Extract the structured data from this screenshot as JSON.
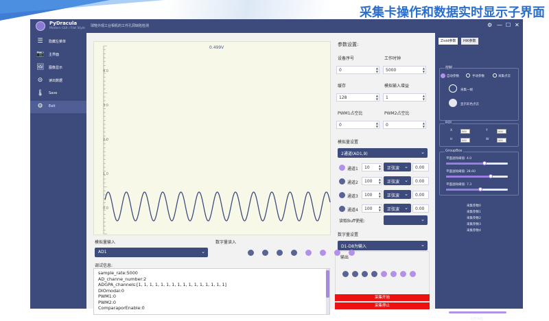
{
  "banner": {
    "title": "采集卡操作和数据实时显示子界面"
  },
  "app": {
    "name": "PyDracula",
    "subtitle": "Modern GUI / Flat Style",
    "description": "球鞋外观工业相机的工件孔洞缺陷检测",
    "controls": [
      "⚙",
      "—",
      "☐",
      "✕"
    ]
  },
  "sidebar": {
    "items": [
      {
        "label": "隐藏左菜单",
        "icon": "menu-icon",
        "glyph": "☰"
      },
      {
        "label": "主界面",
        "icon": "camera-icon",
        "glyph": "📷"
      },
      {
        "label": "图像显示",
        "icon": "image-icon",
        "glyph": "🖼"
      },
      {
        "label": "读出数据",
        "icon": "folder-open-icon",
        "glyph": "⊝"
      },
      {
        "label": "Save",
        "icon": "thermometer-icon",
        "glyph": "🌡"
      },
      {
        "label": "Exit",
        "icon": "chip-icon",
        "glyph": "⚙"
      }
    ]
  },
  "plot": {
    "value_label": "0.499V",
    "y_ticks": [
      "4.0",
      "3.0",
      "2.0",
      "1.0",
      "0.0"
    ],
    "color": "#3c4a7c",
    "background": "#f8f8e8"
  },
  "analog_input": {
    "label": "模拟量输入",
    "selected": "AD1"
  },
  "digital_input": {
    "label": "数字量读入",
    "dots": [
      "dark",
      "dark",
      "dark",
      "dark",
      "lite",
      "lite",
      "lite",
      "lite"
    ]
  },
  "debug": {
    "label": "调试信息:",
    "lines": [
      "sample_rate:5000",
      "AD_channe_number:2",
      "ADGPA_channels:[1, 1, 1, 1, 1, 1, 1, 1, 1, 1, 1, 1, 1, 1, 1, 1]",
      "DIOmodal:0",
      "PWM1:0",
      "PWM2:0",
      "ComparaporEnable:0"
    ]
  },
  "params": {
    "title": "参数设置:",
    "device_label": "设备序号",
    "device_value": "0",
    "clock_label": "工作时钟",
    "clock_value": "5000",
    "cache_label": "缓存",
    "cache_value": "128",
    "gain_label": "模拟输入增益",
    "gain_value": "1",
    "pwm1_label": "PWM1占空比",
    "pwm1_value": "0",
    "pwm2_label": "PWM2占空比",
    "pwm2_value": "0"
  },
  "analog_settings": {
    "title": "模拟量设置",
    "mode": "2通道(AD1,9)",
    "channels": [
      {
        "name": "通道1",
        "gain": "10",
        "wave": "正弦波",
        "value": "0.00",
        "dot": "lite"
      },
      {
        "name": "通道2",
        "gain": "100",
        "wave": "正弦波",
        "value": "0.00",
        "dot": "dark"
      },
      {
        "name": "通道3",
        "gain": "100",
        "wave": "正弦波",
        "value": "0.00",
        "dot": "dark"
      },
      {
        "name": "通道4",
        "gain": "100",
        "wave": "正弦波",
        "value": "0.00",
        "dot": "dark"
      }
    ],
    "buff_label": "读取Buff使能:",
    "buff_value": ""
  },
  "digital_settings": {
    "title": "数字量设置",
    "mode": "D1-D8为输入",
    "output_label": "输出",
    "dots": [
      "dark",
      "dark",
      "dark",
      "dark",
      "lite",
      "lite",
      "lite",
      "lite"
    ]
  },
  "actions": {
    "btn1": "采集开始",
    "btn2": "采集停止"
  },
  "right_panel": {
    "tabs": [
      "Zivid参数",
      "HIK参数"
    ],
    "control_group": "控制",
    "radios": [
      "自动参数",
      "手动参数",
      "采集点云"
    ],
    "capture_one": "采集一帧",
    "show_color_cloud": "显示彩色点云",
    "roi_group": "ROI",
    "roi": {
      "x_label": "X",
      "x_value": "000",
      "y_label": "Y",
      "y_value": "000",
      "h_label": "H",
      "h_value": "000",
      "w_label": "W",
      "w_value": "000"
    },
    "groupbox": "GroupBox",
    "sliders": [
      {
        "label": "平面滤除阈值: 4.0",
        "level": 0.62
      },
      {
        "label": "平面滤除阈值: 28.60",
        "level": 0.72
      },
      {
        "label": "平面滤除阈值: 7.3",
        "level": 0.55
      }
    ],
    "params": [
      "采集参数0",
      "采集参数1",
      "采集参数2",
      "采集参数3",
      "采集参数4"
    ],
    "sync": "同步采集"
  }
}
